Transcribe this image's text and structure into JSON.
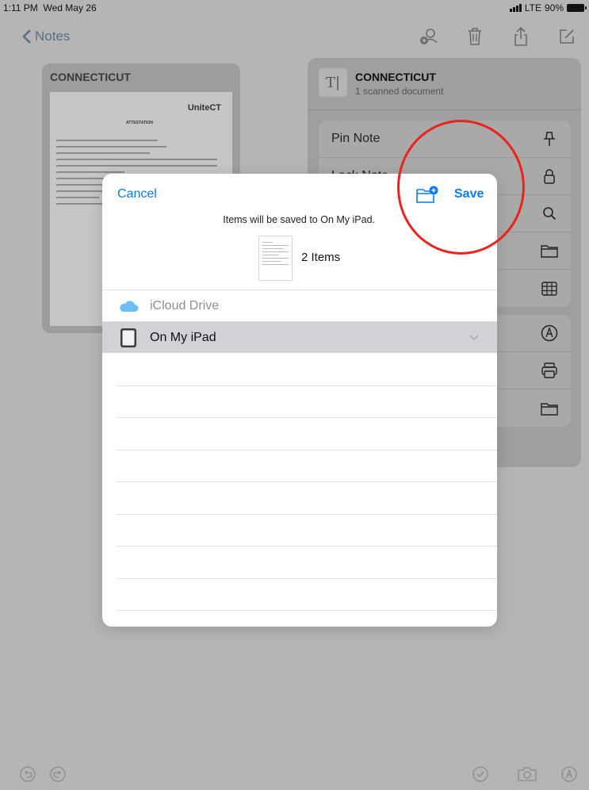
{
  "status_bar": {
    "time": "1:11 PM",
    "date": "Wed May 26",
    "network": "LTE",
    "battery": "90%"
  },
  "nav": {
    "back_label": "Notes",
    "icons": [
      "add-person-icon",
      "trash-icon",
      "share-icon",
      "compose-icon"
    ]
  },
  "note_card": {
    "title": "CONNECTICUT",
    "doc_brand": "UniteCT",
    "doc_heading": "ATTESTATION"
  },
  "share_menu": {
    "title": "CONNECTICUT",
    "subtitle": "1 scanned document",
    "title_icon": "text-format-icon",
    "group1": [
      {
        "label": "Pin Note",
        "icon": "pin-icon"
      },
      {
        "label": "Lock Note",
        "icon": "lock-icon"
      },
      {
        "label": "",
        "icon": "search-icon"
      },
      {
        "label": "",
        "icon": "folder-icon"
      },
      {
        "label": "",
        "icon": "table-icon"
      }
    ],
    "group2": [
      {
        "label": "",
        "icon": "markup-icon"
      },
      {
        "label": "",
        "icon": "print-icon"
      },
      {
        "label": "",
        "icon": "folder-icon"
      }
    ]
  },
  "save_dialog": {
    "cancel_label": "Cancel",
    "save_label": "Save",
    "subtitle": "Items will be saved to On My iPad.",
    "item_count": "2 Items",
    "locations": [
      {
        "label": "iCloud Drive",
        "icon": "cloud-icon",
        "state": "disabled"
      },
      {
        "label": "On My iPad",
        "icon": "ipad-icon",
        "state": "selected"
      }
    ]
  },
  "colors": {
    "accent": "#0a7aff",
    "annotation": "#e8241c",
    "selected_row": "#d1d1d6"
  }
}
